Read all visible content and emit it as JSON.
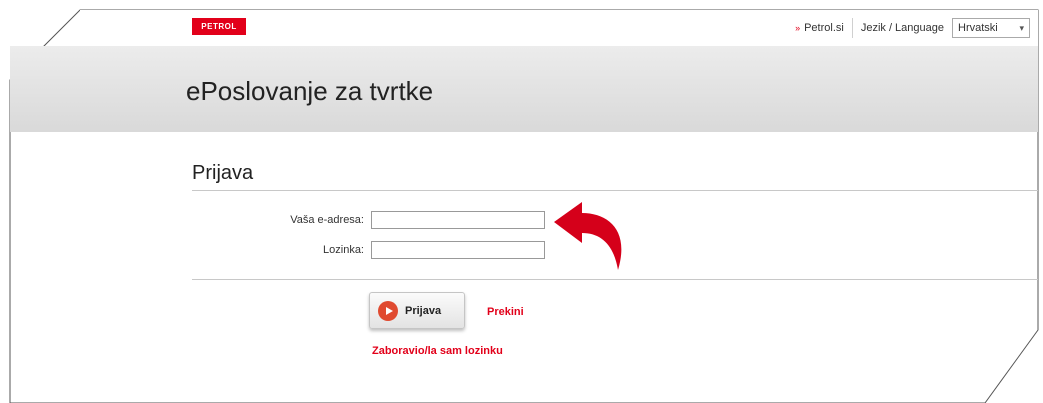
{
  "header": {
    "logo_text": "PETROL",
    "petrol_link": "Petrol.si",
    "language_label": "Jezik / Language",
    "language_selected": "Hrvatski"
  },
  "banner": {
    "title": "ePoslovanje za tvrtke"
  },
  "login_form": {
    "title": "Prijava",
    "email_label": "Vaša e-adresa:",
    "email_value": "",
    "password_label": "Lozinka:",
    "password_value": "",
    "login_button": "Prijava",
    "cancel_link": "Prekini",
    "forgot_link": "Zaboravio/la sam lozinku"
  },
  "icons": {
    "login": "play-circle-icon",
    "hint": "curved-arrow-icon",
    "dropdown": "chevron-down-icon"
  },
  "colors": {
    "brand_red": "#e2001a",
    "button_icon": "#e04a30",
    "band_gray": "#dedede"
  }
}
